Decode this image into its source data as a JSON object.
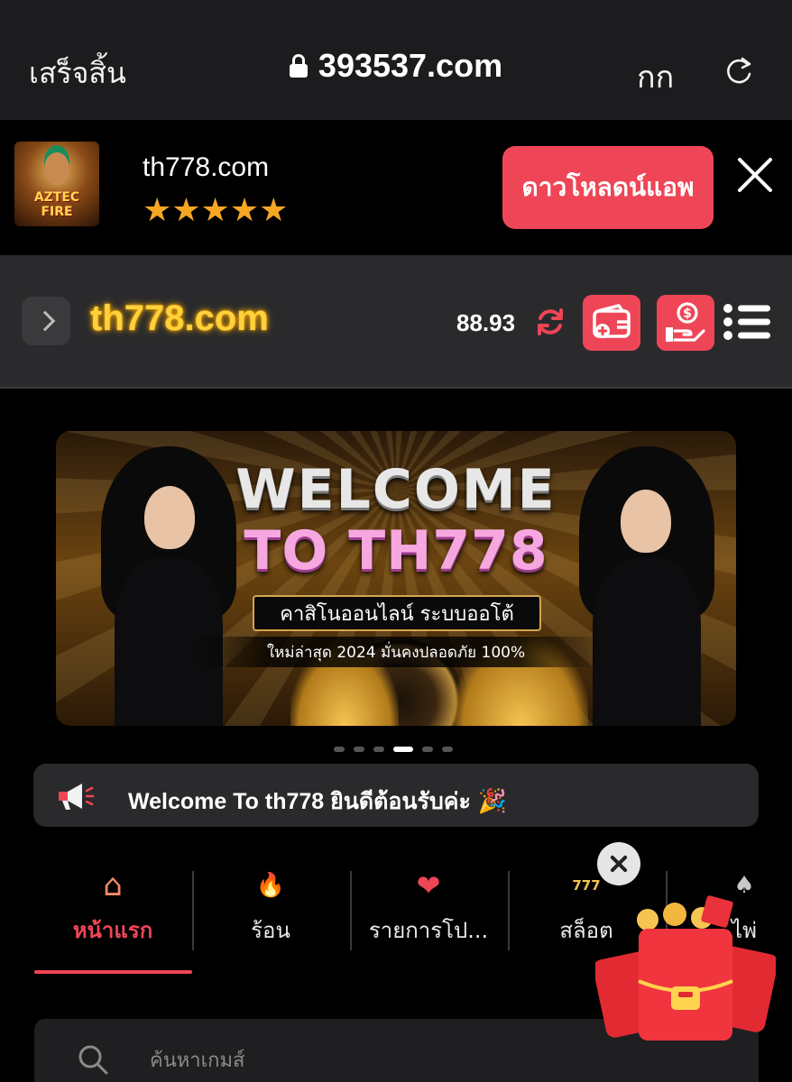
{
  "safari": {
    "done_label": "เสร็จสิ้น",
    "url": "393537.com",
    "text_size_label": "กก"
  },
  "app_banner": {
    "icon_text": "AZTEC FIRE",
    "app_name": "th778.com",
    "rating_stars": "★★★★★",
    "rating": 5,
    "download_label": "ดาวโหลดน์แอพ"
  },
  "site_header": {
    "logo": "th778.com",
    "balance": "88.93"
  },
  "hero": {
    "title_line1": "WELCOME",
    "title_line2": "TO TH778",
    "subtitle1": "คาสิโนออนไลน์ ระบบออโต้",
    "subtitle2": "ใหม่ล่าสุด 2024 มั่นคงปลอดภัย 100%"
  },
  "carousel": {
    "total_slides": 6,
    "active_index": 3
  },
  "announcement": {
    "text": "Welcome To th778 ยินดีต้อนรับค่ะ",
    "emoji": "🎉"
  },
  "tabs": [
    {
      "label": "หน้าแรก",
      "icon": "home-icon",
      "icon_glyph": "⌂",
      "active": true
    },
    {
      "label": "ร้อน",
      "icon": "fire-icon",
      "icon_glyph": "🔥",
      "active": false
    },
    {
      "label": "รายการโป...",
      "icon": "heart-icon",
      "icon_glyph": "❤",
      "active": false
    },
    {
      "label": "สล็อต",
      "icon": "slot-machine-icon",
      "icon_glyph": "777",
      "active": false
    },
    {
      "label": "ไพ่",
      "icon": "cards-icon",
      "icon_glyph": "♠",
      "active": false
    }
  ],
  "search": {
    "placeholder": "ค้นหาเกมส์"
  },
  "colors": {
    "accent": "#ee4657",
    "logo_gold": "#ffd23b",
    "star": "#f5a623",
    "header_bg": "#2a2a2c"
  }
}
